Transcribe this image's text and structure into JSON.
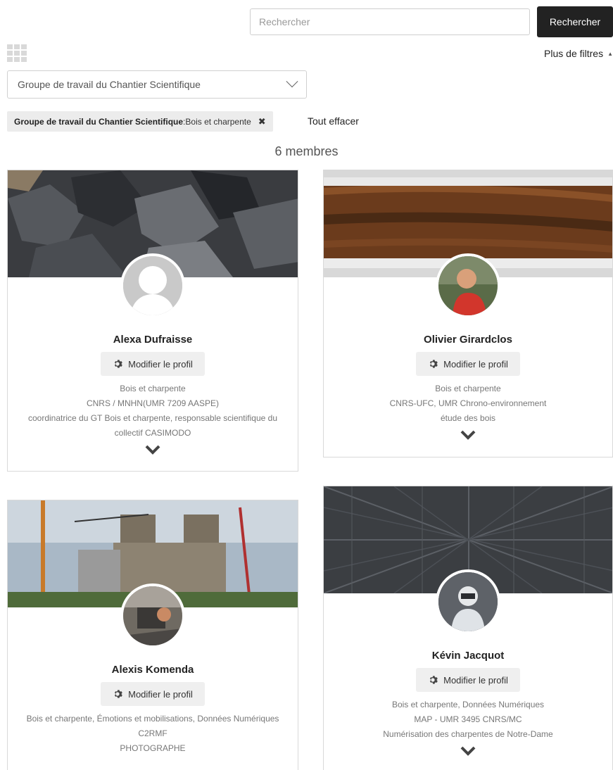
{
  "search": {
    "placeholder": "Rechercher",
    "button_label": "Rechercher"
  },
  "filters": {
    "more_label": "Plus de filtres",
    "group_select_value": "Groupe de travail du Chantier Scientifique",
    "active_chip": {
      "key": "Groupe de travail du Chantier Scientifique",
      "sep": ": ",
      "value": "Bois et charpente",
      "remove": "✖"
    },
    "clear_all": "Tout effacer"
  },
  "members_count": "6 membres",
  "edit_label": "Modifier le profil",
  "members": [
    {
      "name": "Alexa Dufraisse",
      "lines": [
        "Bois et charpente",
        "CNRS / MNHN(UMR 7209 AASPE)",
        "coordinatrice du GT Bois et charpente, responsable scientifique du collectif CASIMODO"
      ]
    },
    {
      "name": "Olivier Girardclos",
      "lines": [
        "Bois et charpente",
        "CNRS-UFC, UMR Chrono-environnement",
        "étude des bois"
      ]
    },
    {
      "name": "Alexis Komenda",
      "lines": [
        "Bois et charpente, Émotions et mobilisations, Données Numériques",
        "C2RMF",
        "PHOTOGRAPHE"
      ]
    },
    {
      "name": "Kévin Jacquot",
      "lines": [
        "Bois et charpente, Données Numériques",
        "MAP - UMR 3495 CNRS/MC",
        "Numérisation des charpentes de Notre-Dame"
      ]
    }
  ],
  "icons": {
    "grid": "grid-icon",
    "gear": "gear-icon",
    "chevron": "chevron-down-icon",
    "caret": "caret-up-icon"
  }
}
